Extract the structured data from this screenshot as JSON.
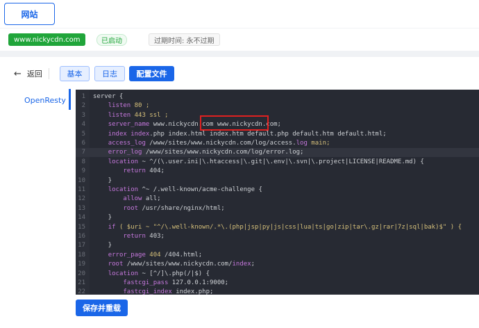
{
  "header": {
    "site_tab": "网站"
  },
  "info": {
    "domain": "www.nickycdn.com",
    "status": "已启动",
    "expire": "过期时间: 永不过期"
  },
  "toolbar": {
    "back_label": "返回",
    "tabs": [
      "基本",
      "日志",
      "配置文件"
    ]
  },
  "sidebar": {
    "items": [
      "OpenResty"
    ]
  },
  "editor": {
    "lines": [
      {
        "n": "1",
        "t": [
          [
            "server {",
            "p"
          ]
        ]
      },
      {
        "n": "2",
        "t": [
          [
            "    ",
            "p"
          ],
          [
            "listen",
            "k"
          ],
          [
            " 80 ;",
            "v"
          ]
        ]
      },
      {
        "n": "3",
        "t": [
          [
            "    ",
            "p"
          ],
          [
            "listen",
            "k"
          ],
          [
            " 443 ssl ;",
            "v"
          ]
        ]
      },
      {
        "n": "4",
        "t": [
          [
            "    ",
            "p"
          ],
          [
            "server_name",
            "k"
          ],
          [
            " www.nickycdn.com www.nickycdn.com;",
            "p"
          ]
        ]
      },
      {
        "n": "5",
        "t": [
          [
            "    ",
            "p"
          ],
          [
            "index",
            "k"
          ],
          [
            " ",
            "p"
          ],
          [
            "index",
            "k"
          ],
          [
            ".php index.html index.htm default.php default.htm default.html;",
            "p"
          ]
        ]
      },
      {
        "n": "6",
        "t": [
          [
            "    ",
            "p"
          ],
          [
            "access_log",
            "k"
          ],
          [
            " /www/sites/www.nickycdn.com/log/access.",
            "p"
          ],
          [
            "log",
            "k"
          ],
          [
            " main;",
            "v"
          ]
        ]
      },
      {
        "n": "7",
        "t": [
          [
            "    ",
            "p"
          ],
          [
            "error_log",
            "k"
          ],
          [
            " /www/sites/www.nickycdn.com/log/error.log;",
            "p"
          ]
        ]
      },
      {
        "n": "8",
        "t": [
          [
            "    ",
            "p"
          ],
          [
            "location",
            "k"
          ],
          [
            " ~ ^/(\\.user.ini|\\.htaccess|\\.git|\\.env|\\.svn|\\.project|LICENSE|README.md) {",
            "p"
          ]
        ]
      },
      {
        "n": "9",
        "t": [
          [
            "        ",
            "p"
          ],
          [
            "return",
            "k"
          ],
          [
            " 404;",
            "p"
          ]
        ]
      },
      {
        "n": "10",
        "t": [
          [
            "    }",
            "p"
          ]
        ]
      },
      {
        "n": "11",
        "t": [
          [
            "    ",
            "p"
          ],
          [
            "location",
            "k"
          ],
          [
            " ^~ /.well-known/acme-challenge {",
            "p"
          ]
        ]
      },
      {
        "n": "12",
        "t": [
          [
            "        ",
            "p"
          ],
          [
            "allow",
            "k"
          ],
          [
            " all;",
            "p"
          ]
        ]
      },
      {
        "n": "13",
        "t": [
          [
            "        ",
            "p"
          ],
          [
            "root",
            "k"
          ],
          [
            " /usr/share/nginx/html;",
            "p"
          ]
        ]
      },
      {
        "n": "14",
        "t": [
          [
            "    }",
            "p"
          ]
        ]
      },
      {
        "n": "15",
        "t": [
          [
            "    ",
            "p"
          ],
          [
            "if",
            "k"
          ],
          [
            " ( $uri ~ \"^/\\.well-known/.*\\.(php|jsp|py|js|css|lua|ts|go|zip|tar\\.gz|rar|7z|sql|bak)$\" ) {",
            "v"
          ]
        ]
      },
      {
        "n": "16",
        "t": [
          [
            "        ",
            "p"
          ],
          [
            "return",
            "k"
          ],
          [
            " 403;",
            "p"
          ]
        ]
      },
      {
        "n": "17",
        "t": [
          [
            "    }",
            "p"
          ]
        ]
      },
      {
        "n": "18",
        "t": [
          [
            "    ",
            "p"
          ],
          [
            "error_page",
            "k"
          ],
          [
            " ",
            "p"
          ],
          [
            "404",
            "v"
          ],
          [
            " /404.html;",
            "p"
          ]
        ]
      },
      {
        "n": "19",
        "t": [
          [
            "    ",
            "p"
          ],
          [
            "root",
            "k"
          ],
          [
            " /www/sites/www.nickycdn.com/",
            "p"
          ],
          [
            "index",
            "k"
          ],
          [
            ";",
            "p"
          ]
        ]
      },
      {
        "n": "20",
        "t": [
          [
            "    ",
            "p"
          ],
          [
            "location",
            "k"
          ],
          [
            " ~ [^/]\\.php(/|$) {",
            "p"
          ]
        ]
      },
      {
        "n": "21",
        "t": [
          [
            "        ",
            "p"
          ],
          [
            "fastcgi_pass",
            "k"
          ],
          [
            " 127.0.0.1:9000;",
            "p"
          ]
        ]
      },
      {
        "n": "22",
        "t": [
          [
            "        ",
            "p"
          ],
          [
            "fastcgi_index",
            "k"
          ],
          [
            " index.php;",
            "p"
          ]
        ]
      }
    ]
  },
  "footer": {
    "save_label": "保存并重载"
  },
  "colors": {
    "accent": "#1a66e8",
    "success": "#20a53a",
    "editor_bg": "#272a33",
    "highlight": "#e02020"
  }
}
